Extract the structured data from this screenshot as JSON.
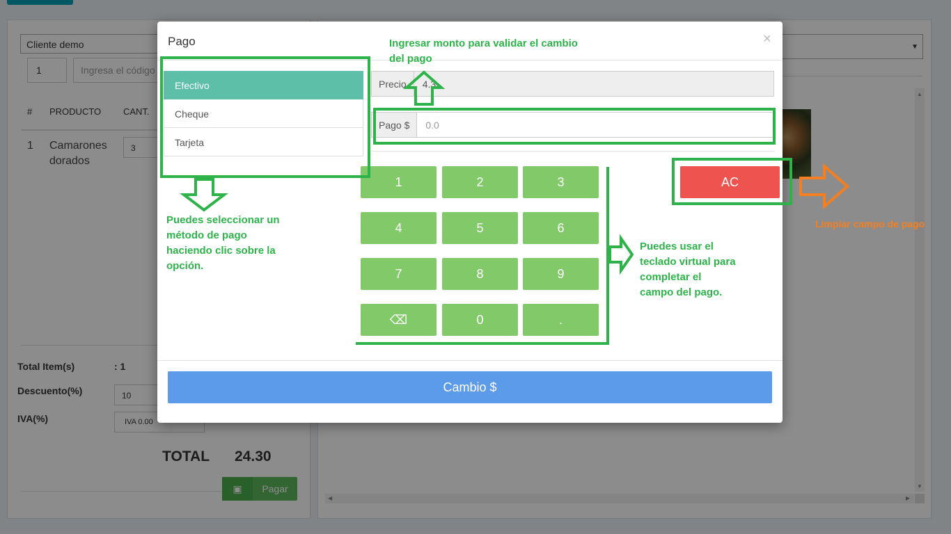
{
  "background": {
    "client_select": "Cliente demo",
    "qty_value": "1",
    "code_placeholder": "Ingresa el código",
    "table_headers": [
      "#",
      "PRODUCTO",
      "CANT."
    ],
    "row": {
      "index": "1",
      "product_line1": "Camarones",
      "product_line2": "dorados",
      "qty": "3"
    },
    "total_items_label": "Total Item(s)",
    "total_items_value": ": 1",
    "discount_label": "Descuento(%)",
    "discount_value": "10",
    "iva_label": "IVA(%)",
    "iva_value": "IVA 0.00",
    "total_label": "TOTAL",
    "total_value": "24.30",
    "pay_label": "Pagar",
    "money_icon": "money-icon"
  },
  "modal": {
    "title": "Pago",
    "close": "×",
    "methods": [
      {
        "label": "Efectivo",
        "active": true
      },
      {
        "label": "Cheque",
        "active": false
      },
      {
        "label": "Tarjeta",
        "active": false
      }
    ],
    "precio_label": "Precio",
    "precio_value": "4.3",
    "pago_label": "Pago $",
    "pago_placeholder": "0.0",
    "keypad": [
      "1",
      "2",
      "3",
      "4",
      "5",
      "6",
      "7",
      "8",
      "9",
      "⌫",
      "0",
      "."
    ],
    "ac_label": "AC",
    "cambio_label": "Cambio $"
  },
  "annotations": {
    "top_note_line1": "Ingresar monto para validar el cambio",
    "top_note_line2": "del pago",
    "method_note": [
      "Puedes seleccionar un",
      "método de pago",
      "haciendo clic sobre la",
      "opción."
    ],
    "keypad_note": [
      "Puedes usar el",
      "teclado virtual para",
      "completar el",
      "campo del pago."
    ],
    "ac_note": "Limpiar campo de pago",
    "green": "#2db34a",
    "orange": "#f57f20"
  },
  "colors": {
    "active_method": "#5ebfa9",
    "keypad": "#82c969",
    "ac": "#ef5350",
    "cambio": "#5b9bea",
    "pay": "#5cb85c"
  }
}
